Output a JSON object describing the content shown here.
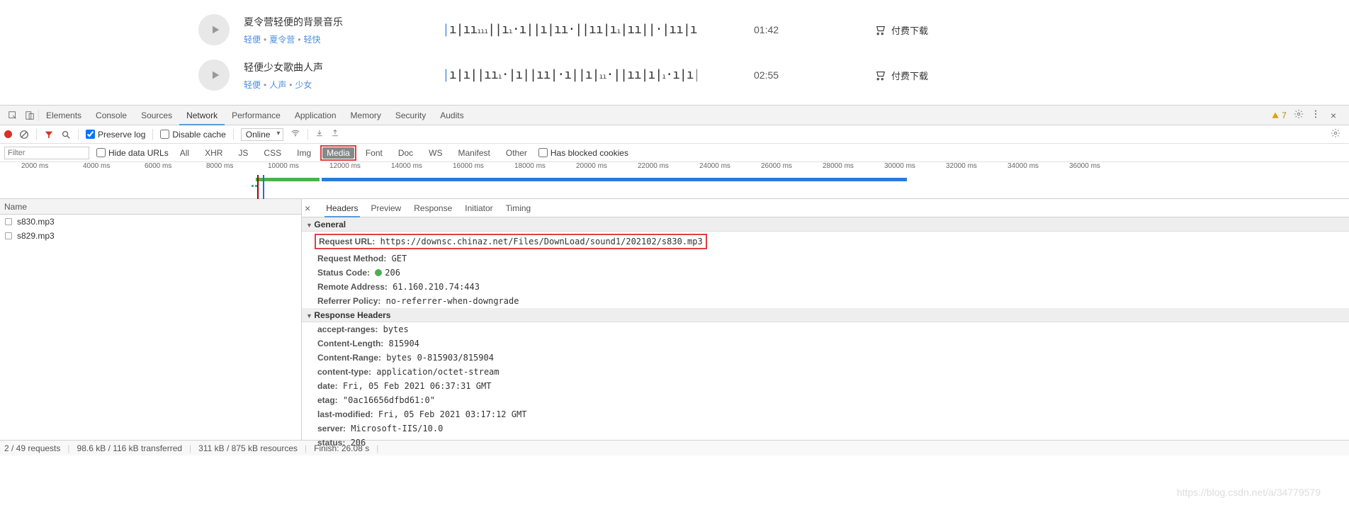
{
  "audio": {
    "items": [
      {
        "title": "夏令营轻便的背景音乐",
        "tags": [
          "轻便",
          "夏令营",
          "轻快"
        ],
        "duration": "01:42",
        "download_label": "付费下载"
      },
      {
        "title": "轻便少女歌曲人声",
        "tags": [
          "轻便",
          "人声",
          "少女"
        ],
        "duration": "02:55",
        "download_label": "付费下载"
      }
    ]
  },
  "devtools": {
    "tabs": [
      "Elements",
      "Console",
      "Sources",
      "Network",
      "Performance",
      "Application",
      "Memory",
      "Security",
      "Audits"
    ],
    "active_tab": "Network",
    "warnings": "7",
    "controls": {
      "preserve_log": "Preserve log",
      "disable_cache": "Disable cache",
      "throttle": "Online"
    },
    "filter": {
      "placeholder": "Filter",
      "hide_data_urls": "Hide data URLs",
      "types": [
        "All",
        "XHR",
        "JS",
        "CSS",
        "Img",
        "Media",
        "Font",
        "Doc",
        "WS",
        "Manifest",
        "Other"
      ],
      "active_type": "Media",
      "has_blocked": "Has blocked cookies"
    },
    "timeline": {
      "ticks": [
        "2000 ms",
        "4000 ms",
        "6000 ms",
        "8000 ms",
        "10000 ms",
        "12000 ms",
        "14000 ms",
        "16000 ms",
        "18000 ms",
        "20000 ms",
        "22000 ms",
        "24000 ms",
        "26000 ms",
        "28000 ms",
        "30000 ms",
        "32000 ms",
        "34000 ms",
        "36000 ms"
      ]
    },
    "name_header": "Name",
    "requests": [
      "s830.mp3",
      "s829.mp3"
    ],
    "detail_tabs": [
      "Headers",
      "Preview",
      "Response",
      "Initiator",
      "Timing"
    ],
    "active_detail_tab": "Headers",
    "general": {
      "title": "General",
      "request_url_k": "Request URL:",
      "request_url_v": "https://downsc.chinaz.net/Files/DownLoad/sound1/202102/s830.mp3",
      "request_method_k": "Request Method:",
      "request_method_v": "GET",
      "status_code_k": "Status Code:",
      "status_code_v": "206",
      "remote_address_k": "Remote Address:",
      "remote_address_v": "61.160.210.74:443",
      "referrer_policy_k": "Referrer Policy:",
      "referrer_policy_v": "no-referrer-when-downgrade"
    },
    "response_headers": {
      "title": "Response Headers",
      "items": [
        {
          "k": "accept-ranges:",
          "v": "bytes"
        },
        {
          "k": "Content-Length:",
          "v": "815904"
        },
        {
          "k": "Content-Range:",
          "v": "bytes 0-815903/815904"
        },
        {
          "k": "content-type:",
          "v": "application/octet-stream"
        },
        {
          "k": "date:",
          "v": "Fri, 05 Feb 2021 06:37:31 GMT"
        },
        {
          "k": "etag:",
          "v": "\"0ac16656dfbd61:0\""
        },
        {
          "k": "last-modified:",
          "v": "Fri, 05 Feb 2021 03:17:12 GMT"
        },
        {
          "k": "server:",
          "v": "Microsoft-IIS/10.0"
        },
        {
          "k": "status:",
          "v": "206"
        }
      ]
    },
    "statusbar": {
      "requests": "2 / 49 requests",
      "transferred": "98.6 kB / 116 kB transferred",
      "resources": "311 kB / 875 kB resources",
      "finish": "Finish: 26.08 s"
    }
  },
  "watermark": "https://blog.csdn.net/a/34779579"
}
